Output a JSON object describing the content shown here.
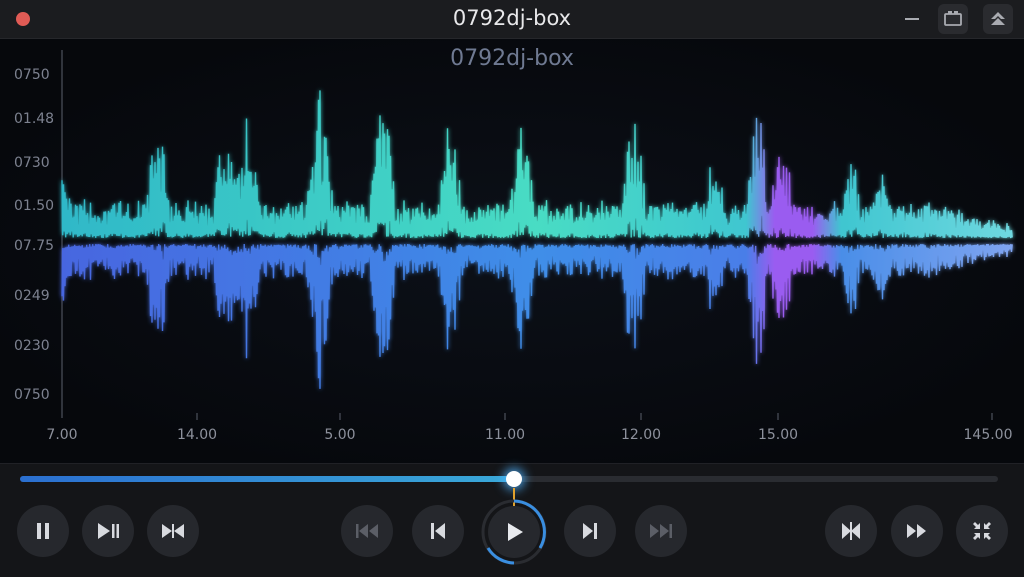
{
  "window": {
    "title": "0792dj-box",
    "icons": [
      "minimize-icon",
      "cast-icon",
      "collapse-up-icon"
    ],
    "close_color": "#e05b55"
  },
  "player": {
    "track_title": "0792dj-box",
    "progress_fraction": 0.505
  },
  "waveform": {
    "y_labels": [
      "0750",
      "01.48",
      "0730",
      "01.50",
      "07.75",
      "0249",
      "0230",
      "0750"
    ],
    "x_labels": [
      "7.00",
      "14.00",
      "5.00",
      "11.00",
      "12.00",
      "15.00",
      "145.00"
    ],
    "colors": {
      "upper": "#45d6c8",
      "lower": "#4f7df0",
      "highlight": "#9a5cf0"
    }
  },
  "controls": {
    "left": [
      "pause-icon",
      "play-pause-icon",
      "crossfade-icon"
    ],
    "center": [
      "rewind-icon",
      "previous-icon",
      "play-icon",
      "next-icon",
      "fast-forward-icon"
    ],
    "right": [
      "shuffle-icon",
      "forward-icon",
      "collapse-icon"
    ]
  }
}
